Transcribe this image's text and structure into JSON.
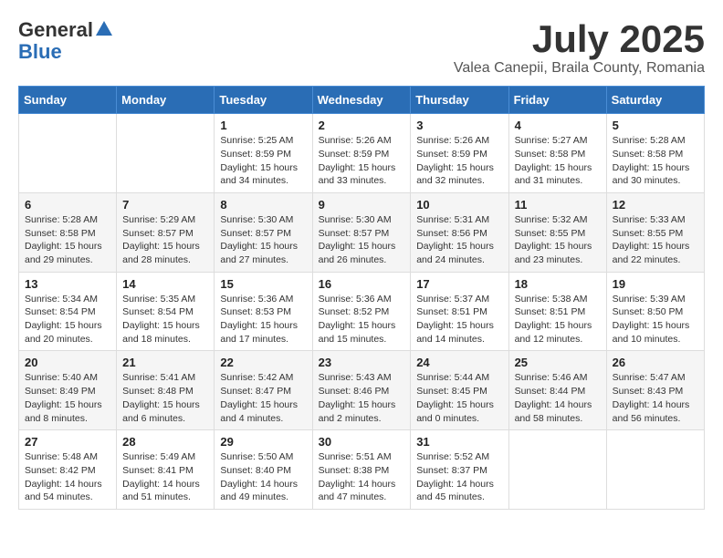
{
  "header": {
    "logo_general": "General",
    "logo_blue": "Blue",
    "month_year": "July 2025",
    "location": "Valea Canepii, Braila County, Romania"
  },
  "calendar": {
    "days_of_week": [
      "Sunday",
      "Monday",
      "Tuesday",
      "Wednesday",
      "Thursday",
      "Friday",
      "Saturday"
    ],
    "weeks": [
      [
        {
          "day": "",
          "info": ""
        },
        {
          "day": "",
          "info": ""
        },
        {
          "day": "1",
          "info": "Sunrise: 5:25 AM\nSunset: 8:59 PM\nDaylight: 15 hours and 34 minutes."
        },
        {
          "day": "2",
          "info": "Sunrise: 5:26 AM\nSunset: 8:59 PM\nDaylight: 15 hours and 33 minutes."
        },
        {
          "day": "3",
          "info": "Sunrise: 5:26 AM\nSunset: 8:59 PM\nDaylight: 15 hours and 32 minutes."
        },
        {
          "day": "4",
          "info": "Sunrise: 5:27 AM\nSunset: 8:58 PM\nDaylight: 15 hours and 31 minutes."
        },
        {
          "day": "5",
          "info": "Sunrise: 5:28 AM\nSunset: 8:58 PM\nDaylight: 15 hours and 30 minutes."
        }
      ],
      [
        {
          "day": "6",
          "info": "Sunrise: 5:28 AM\nSunset: 8:58 PM\nDaylight: 15 hours and 29 minutes."
        },
        {
          "day": "7",
          "info": "Sunrise: 5:29 AM\nSunset: 8:57 PM\nDaylight: 15 hours and 28 minutes."
        },
        {
          "day": "8",
          "info": "Sunrise: 5:30 AM\nSunset: 8:57 PM\nDaylight: 15 hours and 27 minutes."
        },
        {
          "day": "9",
          "info": "Sunrise: 5:30 AM\nSunset: 8:57 PM\nDaylight: 15 hours and 26 minutes."
        },
        {
          "day": "10",
          "info": "Sunrise: 5:31 AM\nSunset: 8:56 PM\nDaylight: 15 hours and 24 minutes."
        },
        {
          "day": "11",
          "info": "Sunrise: 5:32 AM\nSunset: 8:55 PM\nDaylight: 15 hours and 23 minutes."
        },
        {
          "day": "12",
          "info": "Sunrise: 5:33 AM\nSunset: 8:55 PM\nDaylight: 15 hours and 22 minutes."
        }
      ],
      [
        {
          "day": "13",
          "info": "Sunrise: 5:34 AM\nSunset: 8:54 PM\nDaylight: 15 hours and 20 minutes."
        },
        {
          "day": "14",
          "info": "Sunrise: 5:35 AM\nSunset: 8:54 PM\nDaylight: 15 hours and 18 minutes."
        },
        {
          "day": "15",
          "info": "Sunrise: 5:36 AM\nSunset: 8:53 PM\nDaylight: 15 hours and 17 minutes."
        },
        {
          "day": "16",
          "info": "Sunrise: 5:36 AM\nSunset: 8:52 PM\nDaylight: 15 hours and 15 minutes."
        },
        {
          "day": "17",
          "info": "Sunrise: 5:37 AM\nSunset: 8:51 PM\nDaylight: 15 hours and 14 minutes."
        },
        {
          "day": "18",
          "info": "Sunrise: 5:38 AM\nSunset: 8:51 PM\nDaylight: 15 hours and 12 minutes."
        },
        {
          "day": "19",
          "info": "Sunrise: 5:39 AM\nSunset: 8:50 PM\nDaylight: 15 hours and 10 minutes."
        }
      ],
      [
        {
          "day": "20",
          "info": "Sunrise: 5:40 AM\nSunset: 8:49 PM\nDaylight: 15 hours and 8 minutes."
        },
        {
          "day": "21",
          "info": "Sunrise: 5:41 AM\nSunset: 8:48 PM\nDaylight: 15 hours and 6 minutes."
        },
        {
          "day": "22",
          "info": "Sunrise: 5:42 AM\nSunset: 8:47 PM\nDaylight: 15 hours and 4 minutes."
        },
        {
          "day": "23",
          "info": "Sunrise: 5:43 AM\nSunset: 8:46 PM\nDaylight: 15 hours and 2 minutes."
        },
        {
          "day": "24",
          "info": "Sunrise: 5:44 AM\nSunset: 8:45 PM\nDaylight: 15 hours and 0 minutes."
        },
        {
          "day": "25",
          "info": "Sunrise: 5:46 AM\nSunset: 8:44 PM\nDaylight: 14 hours and 58 minutes."
        },
        {
          "day": "26",
          "info": "Sunrise: 5:47 AM\nSunset: 8:43 PM\nDaylight: 14 hours and 56 minutes."
        }
      ],
      [
        {
          "day": "27",
          "info": "Sunrise: 5:48 AM\nSunset: 8:42 PM\nDaylight: 14 hours and 54 minutes."
        },
        {
          "day": "28",
          "info": "Sunrise: 5:49 AM\nSunset: 8:41 PM\nDaylight: 14 hours and 51 minutes."
        },
        {
          "day": "29",
          "info": "Sunrise: 5:50 AM\nSunset: 8:40 PM\nDaylight: 14 hours and 49 minutes."
        },
        {
          "day": "30",
          "info": "Sunrise: 5:51 AM\nSunset: 8:38 PM\nDaylight: 14 hours and 47 minutes."
        },
        {
          "day": "31",
          "info": "Sunrise: 5:52 AM\nSunset: 8:37 PM\nDaylight: 14 hours and 45 minutes."
        },
        {
          "day": "",
          "info": ""
        },
        {
          "day": "",
          "info": ""
        }
      ]
    ]
  }
}
